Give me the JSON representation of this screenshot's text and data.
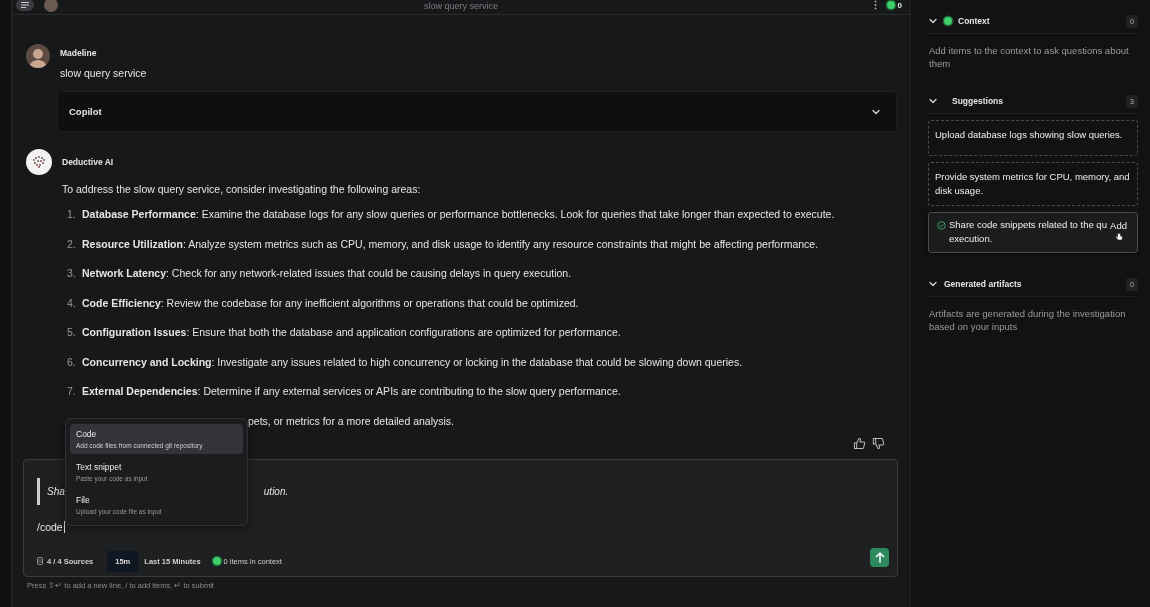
{
  "top_bar": {
    "title": "slow query service",
    "status_count": "0"
  },
  "messages": [
    {
      "kind": "user",
      "author": "Madeline",
      "text": "slow query service",
      "panel": {
        "title": "Copilot",
        "expanded": false
      }
    },
    {
      "kind": "assistant",
      "author": "Deductive AI",
      "intro": "To address the slow query service, consider investigating the following areas:",
      "items": [
        {
          "number": "1.",
          "text": "**Database Performance**: Examine the database logs for any slow queries or performance bottlenecks. Look for queries that take longer than expected to execute."
        },
        {
          "number": "2.",
          "text": "**Resource Utilization**: Analyze system metrics such as CPU, memory, and disk usage to identify any resource constraints that might be affecting performance."
        },
        {
          "number": "3.",
          "text": "**Network Latency**: Check for any network-related issues that could be causing delays in query execution."
        },
        {
          "number": "4.",
          "text": "**Code Efficiency**: Review the codebase for any inefficient algorithms or operations that could be optimized."
        },
        {
          "number": "5.",
          "text": "**Configuration Issues**: Ensure that both the database and application configurations are optimized for performance."
        },
        {
          "number": "6.",
          "text": "**Concurrency and Locking**: Investigate any issues related to high concurrency or locking in the database that could be slowing down queries."
        },
        {
          "number": "7.",
          "text": "**External Dependencies**: Determine if any external services or APIs are contributing to the slow query performance."
        }
      ],
      "closing": "pets, or metrics for a more detailed analysis."
    }
  ],
  "composer": {
    "quote_start": "Sha",
    "quote_end": "ution.",
    "value": "/code",
    "sources": "4 / 4 Sources",
    "time_chip": "15m",
    "time_label": "Last 15 Minutes",
    "context": "0 items in context"
  },
  "command_menu": [
    {
      "title": "Code",
      "description": "Add code files from connected git repository",
      "selected": true
    },
    {
      "title": "Text snippet",
      "description": "Paste your code as input",
      "selected": false
    },
    {
      "title": "File",
      "description": "Upload your code file as input",
      "selected": false
    }
  ],
  "hint": "Press ⇧↵ to add a new line, / to add items, ↵ to submit",
  "sidebar": [
    {
      "kind": "context",
      "title": "Context",
      "count": "0",
      "expanded": true,
      "description": "Add items to the context to ask questions about them"
    },
    {
      "kind": "suggestions",
      "title": "Suggestions",
      "count": "3",
      "expanded": true,
      "suggestions": [
        {
          "text": "Upload database logs showing slow queries.",
          "hovered": false
        },
        {
          "text": "Provide system metrics for CPU, memory, and disk usage.",
          "hovered": false
        },
        {
          "text": "Share code snippets related to the qu",
          "text_after": "execution.",
          "hovered": true,
          "action": "Add"
        }
      ]
    },
    {
      "kind": "artifacts",
      "title": "Generated artifacts",
      "count": "0",
      "expanded": true,
      "description": "Artifacts are generated during the investigation based on your inputs"
    }
  ]
}
